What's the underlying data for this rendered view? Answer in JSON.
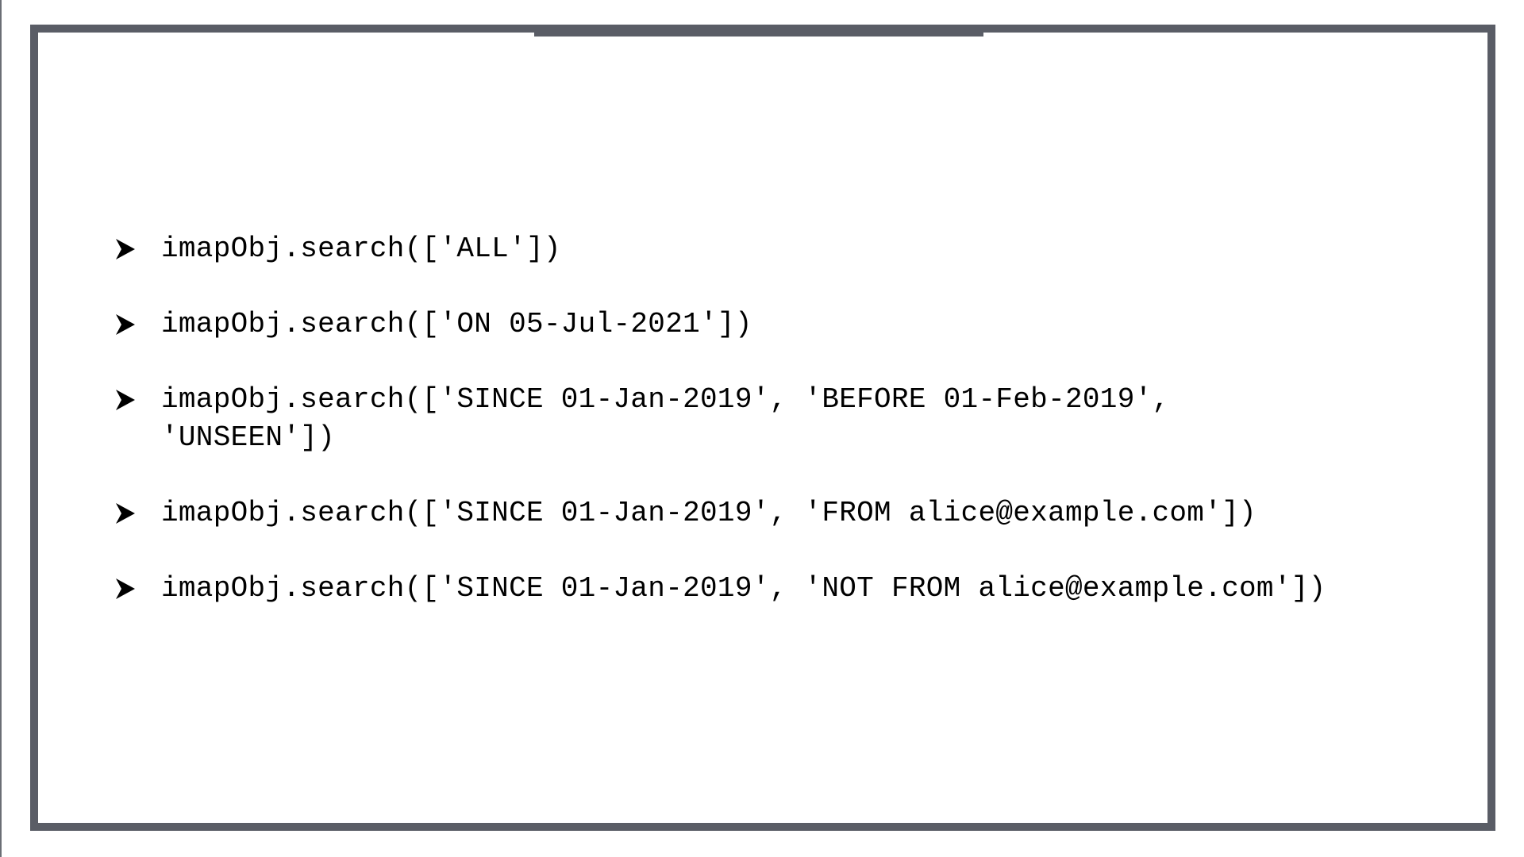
{
  "slide": {
    "bullets": [
      {
        "icon": "arrow-bullet-icon",
        "text": "imapObj.search(['ALL'])"
      },
      {
        "icon": "arrow-bullet-icon",
        "text": "imapObj.search(['ON 05-Jul-2021'])"
      },
      {
        "icon": "arrow-bullet-icon",
        "text": "imapObj.search(['SINCE 01-Jan-2019', 'BEFORE 01-Feb-2019',\n'UNSEEN'])"
      },
      {
        "icon": "arrow-bullet-icon",
        "text": "imapObj.search(['SINCE 01-Jan-2019', 'FROM alice@example.com'])"
      },
      {
        "icon": "arrow-bullet-icon",
        "text": "imapObj.search(['SINCE 01-Jan-2019', 'NOT FROM alice@example.com'])"
      }
    ]
  },
  "colors": {
    "frame": "#5a5d66",
    "text": "#000000",
    "background": "#ffffff"
  }
}
